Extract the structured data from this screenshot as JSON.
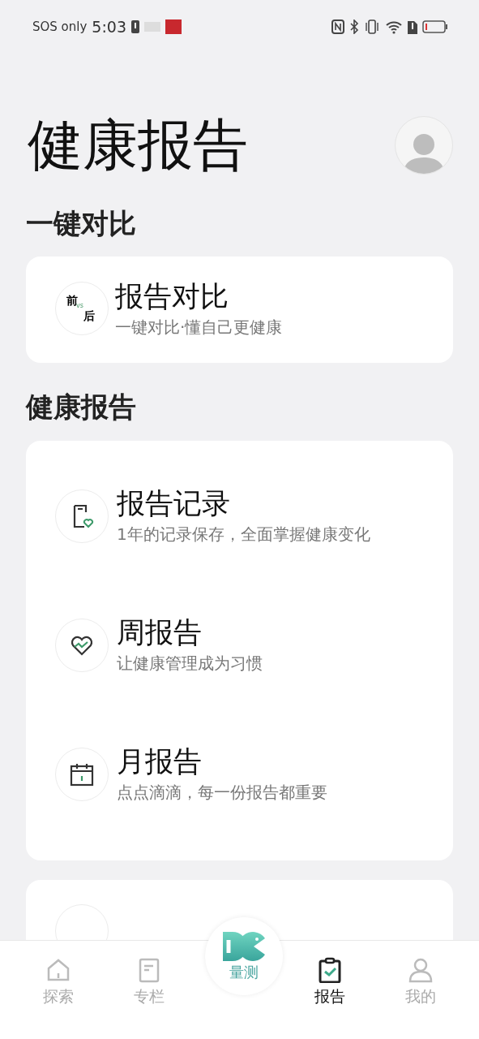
{
  "status_bar": {
    "carrier": "SOS only",
    "time": "5:03"
  },
  "header": {
    "title": "健康报告"
  },
  "sections": [
    {
      "title": "一键对比",
      "items": [
        {
          "kind": "compare",
          "title": "报告对比",
          "subtitle": "一键对比·懂自己更健康",
          "badge_top": "前",
          "badge_mid": "vs",
          "badge_bottom": "后"
        }
      ]
    },
    {
      "title": "健康报告",
      "items": [
        {
          "kind": "record",
          "title": "报告记录",
          "subtitle": "1年的记录保存，全面掌握健康变化"
        },
        {
          "kind": "weekly",
          "title": "周报告",
          "subtitle": "让健康管理成为习惯"
        },
        {
          "kind": "monthly",
          "title": "月报告",
          "subtitle": "点点滴滴，每一份报告都重要"
        }
      ]
    }
  ],
  "tab_bar": {
    "tabs": [
      {
        "kind": "home",
        "label": "探索",
        "selected": false
      },
      {
        "kind": "column",
        "label": "专栏",
        "selected": false
      },
      {
        "kind": "center",
        "label": "量测",
        "selected": false
      },
      {
        "kind": "report",
        "label": "报告",
        "selected": true
      },
      {
        "kind": "profile",
        "label": "我的",
        "selected": false
      }
    ]
  }
}
